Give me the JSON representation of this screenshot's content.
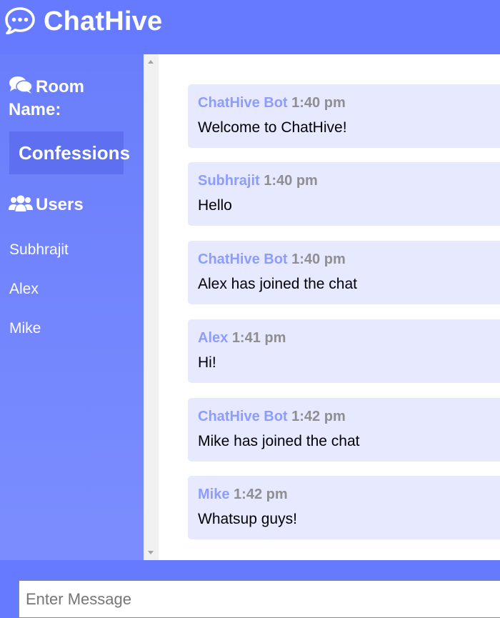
{
  "app": {
    "title": "ChatHive"
  },
  "sidebar": {
    "room_heading": "Room Name:",
    "room_name": "Confessions",
    "users_heading": "Users",
    "users": [
      "Subhrajit",
      "Alex",
      "Mike"
    ]
  },
  "messages": [
    {
      "user": "ChatHive Bot",
      "time": "1:40 pm",
      "text": "Welcome to ChatHive!"
    },
    {
      "user": "Subhrajit",
      "time": "1:40 pm",
      "text": "Hello"
    },
    {
      "user": "ChatHive Bot",
      "time": "1:40 pm",
      "text": "Alex has joined the chat"
    },
    {
      "user": "Alex",
      "time": "1:41 pm",
      "text": "Hi!"
    },
    {
      "user": "ChatHive Bot",
      "time": "1:42 pm",
      "text": "Mike has joined the chat"
    },
    {
      "user": "Mike",
      "time": "1:42 pm",
      "text": "Whatsup guys!"
    }
  ],
  "composer": {
    "placeholder": "Enter Message",
    "value": ""
  },
  "icons": {
    "logo": "comment-dots-icon",
    "room": "comments-icon",
    "users": "users-icon"
  },
  "colors": {
    "brand": "#667aff",
    "message_bg": "#e6e9ff",
    "username": "#8e9dfc",
    "timestamp": "#8f8f8f"
  }
}
